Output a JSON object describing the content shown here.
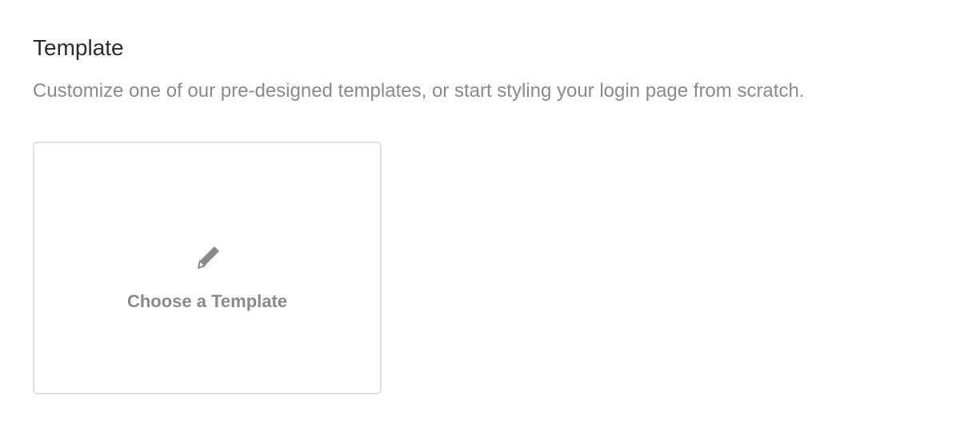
{
  "section": {
    "title": "Template",
    "description": "Customize one of our pre-designed templates, or start styling your login page from scratch."
  },
  "template_card": {
    "label": "Choose a Template",
    "icon": "pencil-icon"
  },
  "colors": {
    "title": "#2b2b2b",
    "muted_text": "#8a8a8a",
    "card_border": "#e0e0e0",
    "icon": "#8a8a8a"
  }
}
